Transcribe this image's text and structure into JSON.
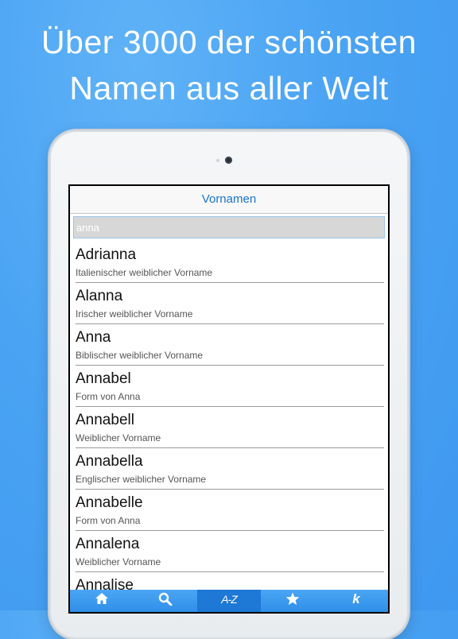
{
  "headline": {
    "line1": "Über 3000 der schönsten",
    "line2": "Namen aus aller Welt"
  },
  "app": {
    "title": "Vornamen",
    "search": {
      "value": "anna",
      "placeholder": ""
    },
    "names": [
      {
        "name": "Adrianna",
        "description": "Italienischer weiblicher Vorname"
      },
      {
        "name": "Alanna",
        "description": "Irischer weiblicher Vorname"
      },
      {
        "name": "Anna",
        "description": "Biblischer weiblicher Vorname"
      },
      {
        "name": "Annabel",
        "description": "Form von Anna"
      },
      {
        "name": "Annabell",
        "description": "Weiblicher Vorname"
      },
      {
        "name": "Annabella",
        "description": "Englischer weiblicher Vorname"
      },
      {
        "name": "Annabelle",
        "description": "Form von Anna"
      },
      {
        "name": "Annalena",
        "description": "Weiblicher Vorname"
      },
      {
        "name": "Annalise",
        "description": ""
      }
    ],
    "tabs": [
      {
        "icon": "home-icon"
      },
      {
        "icon": "search-icon"
      },
      {
        "icon": "az-icon",
        "label": "A-Z",
        "active": true
      },
      {
        "icon": "star-icon"
      },
      {
        "icon": "k-icon",
        "label": "k"
      }
    ]
  },
  "colors": {
    "background": "#4aa3f3",
    "accent": "#1a73c9",
    "tabbar": "#3a9bef",
    "tab_active": "#1d78d6"
  }
}
